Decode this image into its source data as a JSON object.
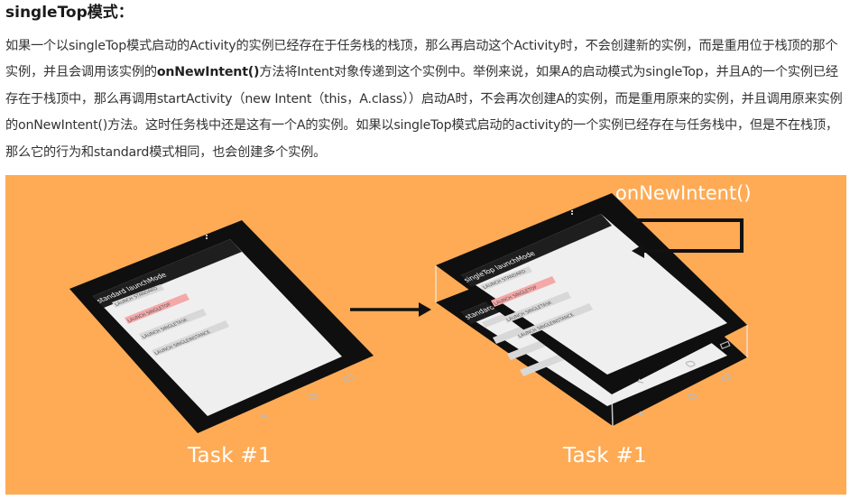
{
  "section": {
    "title": "singleTop模式："
  },
  "paragraph": {
    "part1": "如果一个以singleTop模式启动的Activity的实例已经存在于任务栈的栈顶，那么再启动这个Activity时，不会创建新的实例，而是重用位于栈顶的那个实例，并且会调用该实例的",
    "method_bold": "onNewIntent()",
    "part2": "方法将Intent对象传递到这个实例中。举例来说，如果A的启动模式为singleTop，并且A的一个实例已经存在于栈顶中，那么再调用startActivity（new Intent（this，A.class））启动A时，不会再次创建A的实例，而是重用原来的实例，并且调用原来实例的onNewIntent()方法。这时任务栈中还是这有一个A的实例。如果以singleTop模式启动的activity的一个实例已经存在与任务栈中，但是不在栈顶，那么它的行为和standard模式相同，也会创建多个实例。"
  },
  "figure": {
    "background_color": "#ffab55",
    "left_phone": {
      "app_title": "standard launchMode",
      "buttons": [
        "LAUNCH STANDARD",
        "LAUNCH SINGLETOP",
        "LAUNCH SINGLETASK",
        "LAUNCH SINGLEINSTANCE"
      ],
      "highlighted_index": 1
    },
    "right_front_phone": {
      "app_title": "singleTop launchMode",
      "buttons": [
        "LAUNCH STANDARD",
        "LAUNCH SINGLETOP",
        "LAUNCH SINGLETASK",
        "LAUNCH SINGLEINSTANCE"
      ],
      "highlighted_index": 1
    },
    "right_back_phone": {
      "app_title": "standard launchMode"
    },
    "left_caption": "Task #1",
    "right_caption": "Task #1",
    "intent_label": "onNewIntent()"
  }
}
